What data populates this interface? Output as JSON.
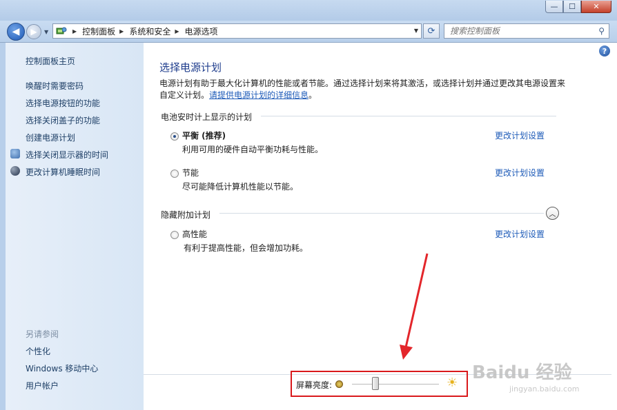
{
  "window": {
    "controls": {
      "minimize": "—",
      "maximize": "☐",
      "close": "✕"
    }
  },
  "nav": {
    "back_glyph": "◀",
    "forward_glyph": "▶",
    "recent_glyph": "▼",
    "breadcrumb": [
      "控制面板",
      "系统和安全",
      "电源选项"
    ],
    "breadcrumb_sep": "▶",
    "dropdown_glyph": "▼",
    "refresh_glyph": "⟳",
    "search_placeholder": "搜索控制面板",
    "search_glyph": "⚲"
  },
  "sidebar": {
    "home": "控制面板主页",
    "items": [
      {
        "label": "唤醒时需要密码"
      },
      {
        "label": "选择电源按钮的功能"
      },
      {
        "label": "选择关闭盖子的功能"
      },
      {
        "label": "创建电源计划"
      },
      {
        "label": "选择关闭显示器的时间",
        "icon": "monitor-shield-icon"
      },
      {
        "label": "更改计算机睡眠时间",
        "icon": "moon-icon"
      }
    ],
    "see_also": {
      "heading": "另请参阅",
      "items": [
        "个性化",
        "Windows 移动中心",
        "用户帐户"
      ]
    }
  },
  "main": {
    "help_glyph": "?",
    "title": "选择电源计划",
    "description": "电源计划有助于最大化计算机的性能或者节能。通过选择计划来将其激活，或选择计划并通过更改其电源设置来自定义计划。",
    "description_link": "请提供电源计划的详细信息",
    "description_end": "。",
    "battery_group": {
      "heading": "电池安时计上显示的计划",
      "plans": [
        {
          "name": "平衡 (推荐)",
          "desc": "利用可用的硬件自动平衡功耗与性能。",
          "checked": true,
          "link": "更改计划设置"
        },
        {
          "name": "节能",
          "desc": "尽可能降低计算机性能以节能。",
          "checked": false,
          "link": "更改计划设置"
        }
      ]
    },
    "hidden_group": {
      "heading": "隐藏附加计划",
      "toggle_glyph": "︿",
      "plans": [
        {
          "name": "高性能",
          "desc": "有利于提高性能，但会增加功耗。",
          "checked": false,
          "link": "更改计划设置"
        }
      ]
    },
    "brightness": {
      "label": "屏幕亮度:",
      "value_fraction": 0.25,
      "bright_glyph": "☀"
    }
  },
  "colors": {
    "accent_link": "#1e5bb8",
    "title_blue": "#1e3c8c",
    "highlight_red": "#d9181b",
    "annotation_arrow": "#e3262b"
  },
  "watermark": {
    "big": "Baidu 经验",
    "small": "jingyan.baidu.com"
  }
}
